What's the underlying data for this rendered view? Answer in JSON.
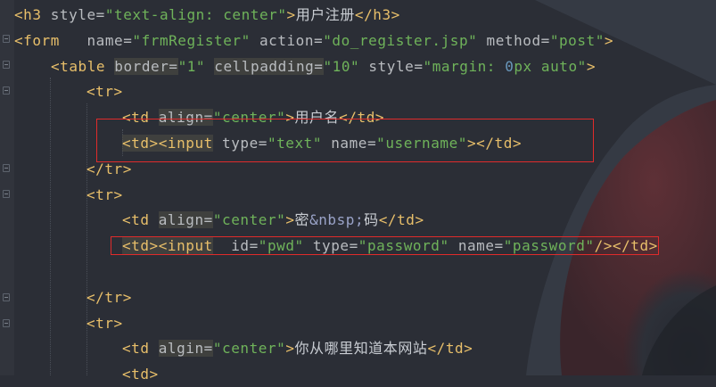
{
  "editor": {
    "lines": [
      [
        {
          "k": "t",
          "v": "<h3 "
        },
        {
          "k": "a",
          "v": "style="
        },
        {
          "k": "s",
          "v": "\"text-align: "
        },
        {
          "k": "s",
          "v": "center\""
        },
        {
          "k": "t",
          "v": ">"
        },
        {
          "k": "c",
          "v": "用户注册"
        },
        {
          "k": "t",
          "v": "</h3>"
        }
      ],
      [
        {
          "k": "t",
          "v": "<form   "
        },
        {
          "k": "a",
          "v": "name="
        },
        {
          "k": "s",
          "v": "\"frmRegister\" "
        },
        {
          "k": "a",
          "v": "action="
        },
        {
          "k": "s",
          "v": "\"do_register.jsp\" "
        },
        {
          "k": "a",
          "v": "method="
        },
        {
          "k": "s",
          "v": "\"post\""
        },
        {
          "k": "t",
          "v": ">"
        }
      ],
      [
        {
          "k": "t",
          "v": "<table "
        },
        {
          "k": "a",
          "v": "border=",
          "h": 1
        },
        {
          "k": "s",
          "v": "\"1\" "
        },
        {
          "k": "a",
          "v": "cellpadding=",
          "h": 1
        },
        {
          "k": "s",
          "v": "\"10\" "
        },
        {
          "k": "a",
          "v": "style="
        },
        {
          "k": "s",
          "v": "\"margin: "
        },
        {
          "k": "n",
          "v": "0"
        },
        {
          "k": "s",
          "v": "px auto\""
        },
        {
          "k": "t",
          "v": ">"
        }
      ],
      [
        {
          "k": "t",
          "v": "<tr>"
        }
      ],
      [
        {
          "k": "t",
          "v": "<td "
        },
        {
          "k": "a",
          "v": "align=",
          "h": 1
        },
        {
          "k": "s",
          "v": "\"center\""
        },
        {
          "k": "t",
          "v": ">"
        },
        {
          "k": "c",
          "v": "用户名"
        },
        {
          "k": "t",
          "v": "</td>"
        }
      ],
      [
        {
          "k": "t",
          "v": "<td><input",
          "h": 1
        },
        {
          "k": "t",
          "v": " "
        },
        {
          "k": "a",
          "v": "type="
        },
        {
          "k": "s",
          "v": "\"text\" "
        },
        {
          "k": "a",
          "v": "name="
        },
        {
          "k": "s",
          "v": "\"username\""
        },
        {
          "k": "t",
          "v": "></td>"
        }
      ],
      [
        {
          "k": "t",
          "v": "</tr>"
        }
      ],
      [
        {
          "k": "t",
          "v": "<tr>"
        }
      ],
      [
        {
          "k": "t",
          "v": "<td "
        },
        {
          "k": "a",
          "v": "align=",
          "h": 1
        },
        {
          "k": "s",
          "v": "\"center\""
        },
        {
          "k": "t",
          "v": ">"
        },
        {
          "k": "c",
          "v": "密"
        },
        {
          "k": "e",
          "v": "&nbsp;"
        },
        {
          "k": "c",
          "v": "码"
        },
        {
          "k": "t",
          "v": "</td>"
        }
      ],
      [
        {
          "k": "t",
          "v": "<td><input",
          "h": 1
        },
        {
          "k": "t",
          "v": "  "
        },
        {
          "k": "a",
          "v": "id="
        },
        {
          "k": "s",
          "v": "\"pwd\" "
        },
        {
          "k": "a",
          "v": "type="
        },
        {
          "k": "s",
          "v": "\"password\" "
        },
        {
          "k": "a",
          "v": "name="
        },
        {
          "k": "s",
          "v": "\"password\""
        },
        {
          "k": "t",
          "v": "/></td>"
        }
      ],
      [],
      [
        {
          "k": "t",
          "v": "</tr>"
        }
      ],
      [
        {
          "k": "t",
          "v": "<tr>"
        }
      ],
      [
        {
          "k": "t",
          "v": "<td "
        },
        {
          "k": "a",
          "v": "algin=",
          "h": 1
        },
        {
          "k": "s",
          "v": "\"center\""
        },
        {
          "k": "t",
          "v": ">"
        },
        {
          "k": "c",
          "v": "你从哪里知道本网站"
        },
        {
          "k": "t",
          "v": "</td>"
        }
      ],
      [
        {
          "k": "t",
          "v": "<td>"
        }
      ]
    ]
  }
}
